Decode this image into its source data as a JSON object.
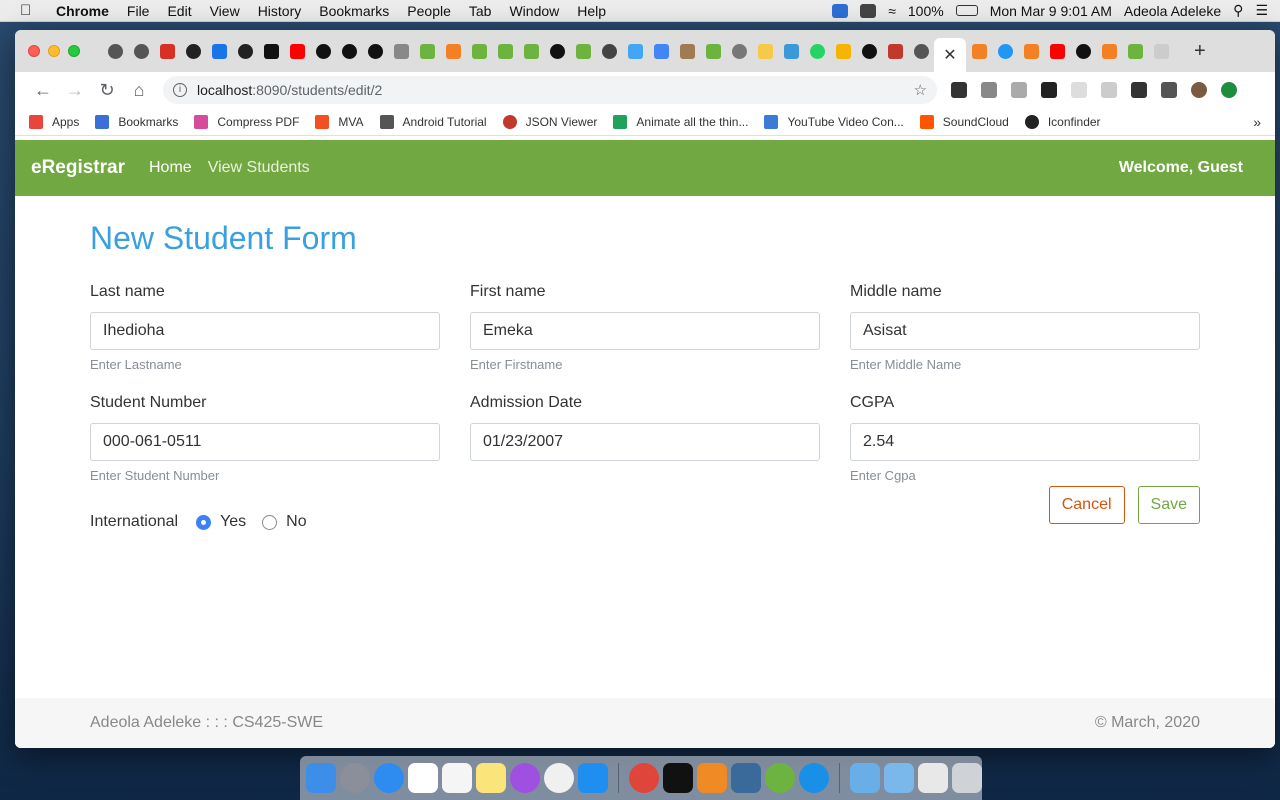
{
  "menubar": {
    "app": "Chrome",
    "items": [
      "File",
      "Edit",
      "View",
      "History",
      "Bookmarks",
      "People",
      "Tab",
      "Window",
      "Help"
    ],
    "battery": "100%",
    "clock": "Mon Mar 9  9:01 AM",
    "user": "Adeola Adeleke"
  },
  "browser": {
    "url_host": "localhost",
    "url_path": ":8090/students/edit/2",
    "bookmarks": [
      {
        "label": "Apps",
        "icon": "apps-grid-icon",
        "color": "#e8453c"
      },
      {
        "label": "Bookmarks",
        "icon": "star-icon",
        "color": "#3b6fd8"
      },
      {
        "label": "Compress PDF",
        "icon": "compress-pdf-icon",
        "color": "#d64b9a"
      },
      {
        "label": "MVA",
        "icon": "microsoft-icon",
        "color": "#f25022"
      },
      {
        "label": "Android Tutorial",
        "icon": "android-tutorial-icon",
        "color": "#555555"
      },
      {
        "label": "JSON Viewer",
        "icon": "json-viewer-icon",
        "color": "#c0392b"
      },
      {
        "label": "Animate all the thin...",
        "icon": "medium-icon",
        "color": "#1fa35c"
      },
      {
        "label": "YouTube Video Con...",
        "icon": "youtube-converter-icon",
        "color": "#3a7bd5"
      },
      {
        "label": "SoundCloud",
        "icon": "soundcloud-icon",
        "color": "#ff5500"
      },
      {
        "label": "Iconfinder",
        "icon": "iconfinder-icon",
        "color": "#222222"
      }
    ]
  },
  "site": {
    "brand": "eRegistrar",
    "nav": [
      "Home",
      "View Students"
    ],
    "welcome": "Welcome, Guest"
  },
  "form": {
    "title": "New Student Form",
    "fields": [
      {
        "label": "Last name",
        "value": "Ihedioha",
        "help": "Enter Lastname"
      },
      {
        "label": "First name",
        "value": "Emeka",
        "help": "Enter Firstname"
      },
      {
        "label": "Middle name",
        "value": "Asisat",
        "help": "Enter Middle Name"
      },
      {
        "label": "Student Number",
        "value": "000-061-0511",
        "help": "Enter Student Number"
      },
      {
        "label": "Admission Date",
        "value": "01/23/2007",
        "help": ""
      },
      {
        "label": "CGPA",
        "value": "2.54",
        "help": "Enter Cgpa"
      }
    ],
    "international_label": "International",
    "options": [
      "Yes",
      "No"
    ],
    "selected": "Yes",
    "cancel": "Cancel",
    "save": "Save"
  },
  "footer": {
    "left": "Adeola Adeleke : : : CS425-SWE",
    "right": "© March, 2020"
  },
  "colors": {
    "navbar": "#71a842",
    "title": "#3ba0e0",
    "cancel": "#d2570d",
    "save": "#71a842",
    "radio_selected": "#3b82f6"
  }
}
